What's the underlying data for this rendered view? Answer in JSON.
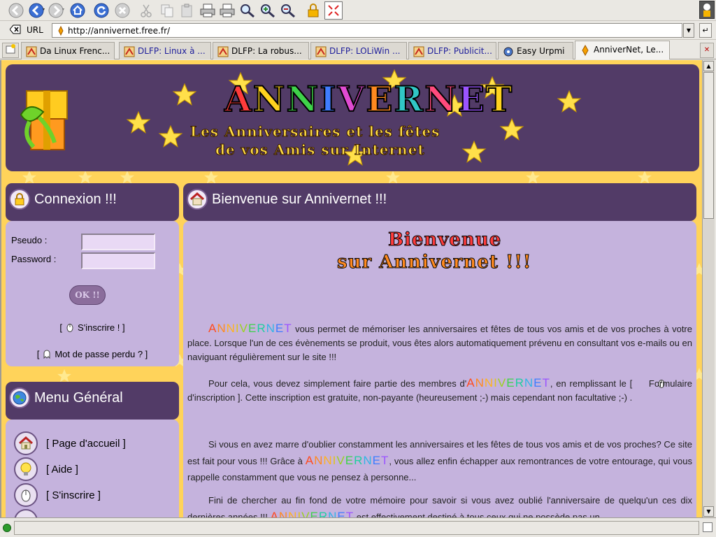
{
  "browser": {
    "url_label": "URL",
    "url": "http://annivernet.free.fr/",
    "tabs": [
      {
        "label": "Da Linux Frenc..."
      },
      {
        "label": "DLFP: Linux à ..."
      },
      {
        "label": "DLFP: La robus..."
      },
      {
        "label": "DLFP: LOLiWin ..."
      },
      {
        "label": "DLFP: Publicit..."
      },
      {
        "label": "Easy Urpmi"
      },
      {
        "label": "AnniverNet, Le..."
      }
    ],
    "active_tab": 6,
    "toolbar_icons": [
      "back-icon",
      "forward-icon",
      "reload-icon",
      "home-icon",
      "refresh-icon",
      "stop-icon",
      "cut-icon",
      "copy-icon",
      "paste-icon",
      "print-icon",
      "print-preview-icon",
      "find-icon",
      "zoom-in-icon",
      "zoom-out-icon",
      "lock-icon",
      "fullscreen-icon"
    ]
  },
  "site": {
    "logo_title": [
      "A",
      "N",
      "N",
      "I",
      "V",
      "E",
      "R",
      "N",
      "E",
      "T"
    ],
    "tagline_line1": "Les Anniversaires et les fêtes",
    "tagline_line2": "de vos Amis sur Internet",
    "colors": {
      "panel_header": "#523b67",
      "panel_body": "#c5b3dd",
      "background": "#ffd35a"
    }
  },
  "login": {
    "title": "Connexion !!!",
    "pseudo_label": "Pseudo :",
    "password_label": "Password :",
    "submit_label": "OK !!",
    "register_link": "S'inscrire !",
    "lost_password_link": "Mot de passe perdu ?"
  },
  "menu": {
    "title": "Menu Général",
    "items": [
      {
        "label": "[ Page d'accueil ]",
        "icon": "house-icon"
      },
      {
        "label": "[ Aide ]",
        "icon": "lightbulb-icon"
      },
      {
        "label": "[ S'inscrire ]",
        "icon": "mouse-icon"
      }
    ]
  },
  "main": {
    "title": "Bienvenue sur Annivernet !!!",
    "welcome_art_line1": "Bienvenue",
    "welcome_art_line2": "sur Annivernet !!!",
    "brand": "ANNIVERNET",
    "p1_text": " vous permet de mémoriser les anniversaires et fêtes de tous vos amis et de vos proches à votre place. Lorsque l'un de ces évènements se produit, vous êtes alors automatiquement prévenu en consultant vos e-mails ou en naviguant régulièrement sur le site !!!",
    "p2_before": "Pour cela, vous devez simplement faire partie des membres d'",
    "p2_after": ", en remplissant le",
    "p2_link": "Formulaire d'inscription",
    "p2_end": ". Cette inscription est gratuite, non-payante (heureusement ;-) mais cependant non facultative ;-) .",
    "p3_before": "Si vous en avez marre d'oublier constamment les anniversaires et les fêtes de tous vos amis et de vos proches? Ce site est fait pour vous !!! Grâce à ",
    "p3_after": ", vous allez enfin échapper aux remontrances de votre entourage, qui vous rappelle constamment que vous ne pensez à personne...",
    "p4_before": "Fini de chercher au fin fond de votre mémoire pour savoir si vous avez oublié l'anniversaire de quelqu'un ces dix dernières années !!! ",
    "p4_after": " est effectivement destiné à tous ceux qui ne possède pas un"
  }
}
